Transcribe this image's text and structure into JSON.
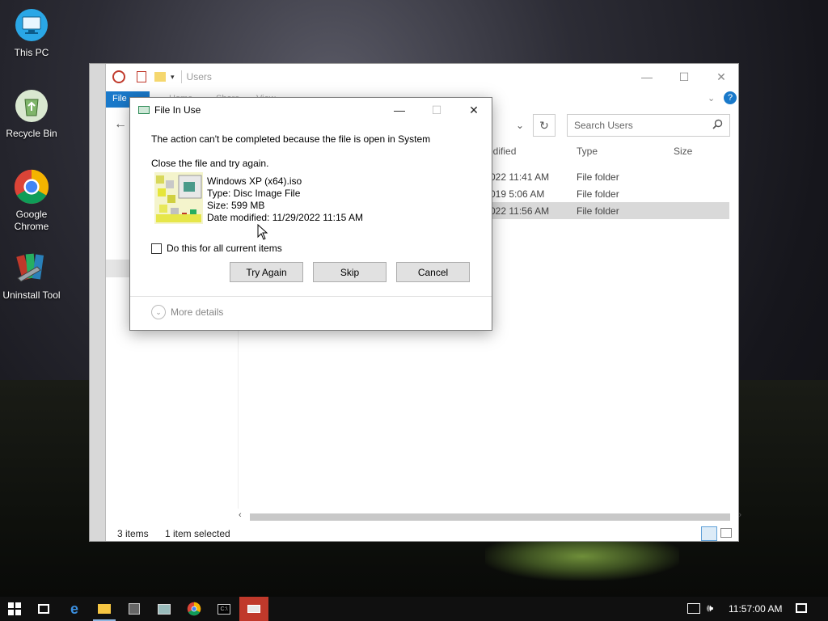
{
  "desktop": {
    "icons": [
      {
        "label": "This PC",
        "icon": "monitor-icon"
      },
      {
        "label": "Recycle Bin",
        "icon": "recycle-bin-icon"
      },
      {
        "label": "Google Chrome",
        "icon": "chrome-icon"
      },
      {
        "label": "Uninstall Tool",
        "icon": "uninstall-tool-icon"
      }
    ]
  },
  "explorer": {
    "title": "Users",
    "ribbon_tabs": [
      "File",
      "Home",
      "Share",
      "View"
    ],
    "search_placeholder": "Search Users",
    "columns": {
      "modified": "odified",
      "type": "Type",
      "size": "Size"
    },
    "rows": [
      {
        "modified": "022 11:41 AM",
        "type": "File folder",
        "selected": false
      },
      {
        "modified": "019 5:06 AM",
        "type": "File folder",
        "selected": false
      },
      {
        "modified": "022 11:56 AM",
        "type": "File folder",
        "selected": true
      }
    ],
    "status": {
      "count": "3 items",
      "selection": "1 item selected"
    }
  },
  "dialog": {
    "title": "File In Use",
    "message": "The action can't be completed because the file is open in System",
    "instruction": "Close the file and try again.",
    "file": {
      "name": "Windows XP (x64).iso",
      "type": "Type: Disc Image File",
      "size": "Size: 599 MB",
      "modified": "Date modified: 11/29/2022 11:15 AM"
    },
    "checkbox_label": "Do this for all current items",
    "buttons": {
      "try_again": "Try Again",
      "skip": "Skip",
      "cancel": "Cancel"
    },
    "more_details": "More details"
  },
  "taskbar": {
    "clock": "11:57:00 AM"
  },
  "colors": {
    "accent": "#1979ca",
    "selected_row": "#d9d9d9",
    "taskbar": "#101010"
  }
}
